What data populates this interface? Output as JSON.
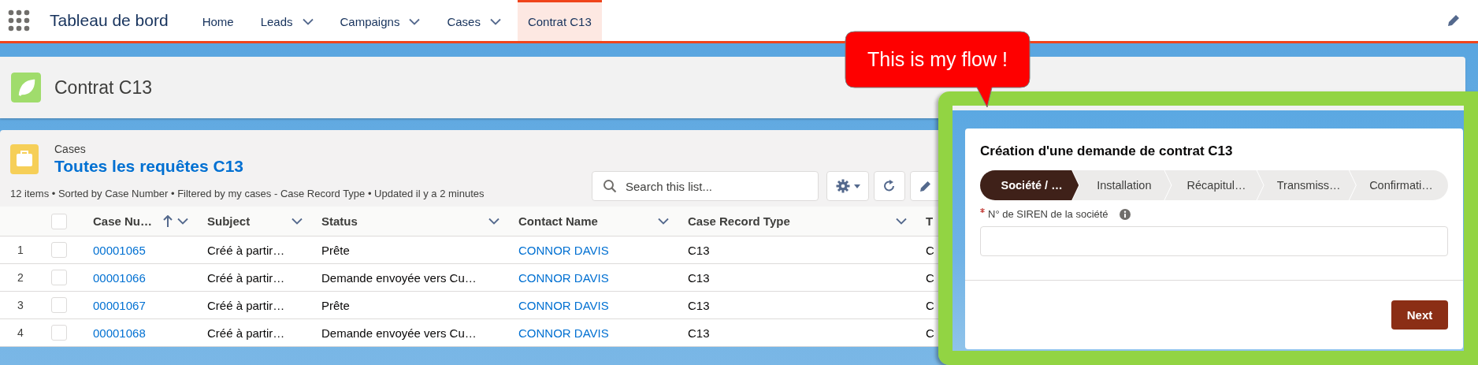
{
  "nav": {
    "app_name": "Tableau de bord",
    "items": [
      {
        "label": "Home",
        "has_menu": false,
        "selected": false
      },
      {
        "label": "Leads",
        "has_menu": true,
        "selected": false
      },
      {
        "label": "Campaigns",
        "has_menu": true,
        "selected": false
      },
      {
        "label": "Cases",
        "has_menu": true,
        "selected": false
      },
      {
        "label": "Contrat C13",
        "has_menu": false,
        "selected": true
      }
    ]
  },
  "page_header": {
    "title": "Contrat C13"
  },
  "list": {
    "object": "Cases",
    "title": "Toutes les requêtes C13",
    "summary": "12 items • Sorted by Case Number • Filtered by my cases - Case Record Type • Updated il y a 2 minutes",
    "search": {
      "placeholder": "Search this list..."
    },
    "all_selected": false,
    "columns": [
      {
        "label": "Case Nu…",
        "kind": "link",
        "sorted": true,
        "has_menu": true
      },
      {
        "label": "Subject",
        "kind": "text",
        "sorted": false,
        "has_menu": true
      },
      {
        "label": "Status",
        "kind": "text",
        "sorted": false,
        "has_menu": true
      },
      {
        "label": "Contact Name",
        "kind": "link",
        "sorted": false,
        "has_menu": true
      },
      {
        "label": "Case Record Type",
        "kind": "text",
        "sorted": false,
        "has_menu": true
      },
      {
        "label": "T",
        "kind": "text",
        "sorted": false,
        "has_menu": false
      }
    ],
    "rows": [
      {
        "number": "1",
        "selected": false,
        "cells": [
          "00001065",
          "Créé à partir…",
          "Prête",
          "CONNOR DAVIS",
          "C13",
          "C"
        ]
      },
      {
        "number": "2",
        "selected": false,
        "cells": [
          "00001066",
          "Créé à partir…",
          "Demande envoyée vers Cu…",
          "CONNOR DAVIS",
          "C13",
          "C"
        ]
      },
      {
        "number": "3",
        "selected": false,
        "cells": [
          "00001067",
          "Créé à partir…",
          "Prête",
          "CONNOR DAVIS",
          "C13",
          "C"
        ]
      },
      {
        "number": "4",
        "selected": false,
        "cells": [
          "00001068",
          "Créé à partir…",
          "Demande envoyée vers Cu…",
          "CONNOR DAVIS",
          "C13",
          "C"
        ]
      }
    ]
  },
  "callout": {
    "text": "This is my flow !"
  },
  "flow": {
    "title": "Création d'une demande de contrat C13",
    "steps": [
      {
        "label": "Société / …",
        "selected": true
      },
      {
        "label": "Installation",
        "selected": false
      },
      {
        "label": "Récapitul…",
        "selected": false
      },
      {
        "label": "Transmiss…",
        "selected": false
      },
      {
        "label": "Confirmati…",
        "selected": false
      }
    ],
    "field": {
      "label": "N° de SIREN de la société",
      "required": true
    },
    "buttons": [
      "Next"
    ]
  }
}
